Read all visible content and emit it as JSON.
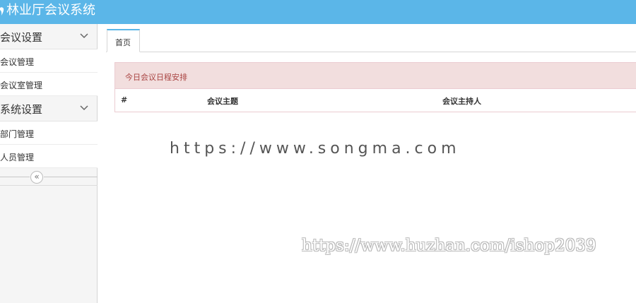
{
  "app": {
    "title": "林业厅会议系统"
  },
  "sidebar": {
    "groups": [
      {
        "label": "会议设置",
        "items": [
          {
            "label": "会议管理"
          },
          {
            "label": "会议室管理"
          }
        ]
      },
      {
        "label": "系统设置",
        "items": [
          {
            "label": "部门管理"
          },
          {
            "label": "人员管理"
          }
        ]
      }
    ],
    "collapse_glyph": "«"
  },
  "tabs": [
    {
      "label": "首页"
    }
  ],
  "panel": {
    "heading": "今日会议日程安排",
    "columns": [
      "#",
      "会议主题",
      "会议主持人"
    ]
  },
  "watermarks": [
    "https://www.songma.com",
    "https://www.huzhan.com/ishop2039"
  ],
  "colors": {
    "header_bg": "#5bb6e8",
    "panel_heading_bg": "#f2dede",
    "panel_heading_text": "#a94442"
  }
}
